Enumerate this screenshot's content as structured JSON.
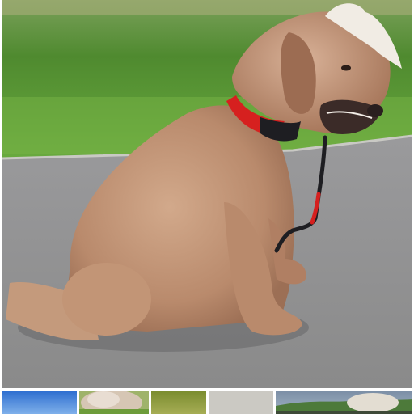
{
  "photo": {
    "subject": "dog-photo",
    "colors": {
      "grass": "#5f9a3c",
      "pavement": "#8d8d8d",
      "fur": "#c09478",
      "collar": "#d6201f",
      "leash": "#1e1e22"
    }
  },
  "thumbnails": [
    {
      "name": "thumbnail-1",
      "color": "#4f86d6"
    },
    {
      "name": "thumbnail-2",
      "color": "#cdbfae"
    },
    {
      "name": "thumbnail-3",
      "color": "#8a9a3a"
    },
    {
      "name": "thumbnail-4",
      "color": "#c8c6c0"
    },
    {
      "name": "thumbnail-5",
      "color": "#7d8b6a"
    }
  ]
}
